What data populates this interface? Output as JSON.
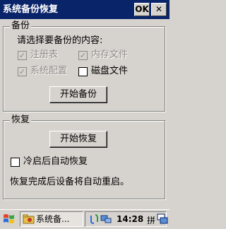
{
  "window": {
    "title": "系统备份恢复",
    "ok_label": "OK",
    "close_label": "✕"
  },
  "backup": {
    "group_title": "备份",
    "prompt": "请选择要备份的内容:",
    "options": [
      {
        "label": "注册表",
        "checked": true,
        "enabled": false
      },
      {
        "label": "内存文件",
        "checked": true,
        "enabled": false
      },
      {
        "label": "系统配置",
        "checked": true,
        "enabled": false
      },
      {
        "label": "磁盘文件",
        "checked": false,
        "enabled": true
      }
    ],
    "start_button": "开始备份"
  },
  "restore": {
    "group_title": "恢复",
    "start_button": "开始恢复",
    "auto_restore_label": "冷启后自动恢复",
    "auto_restore_checked": false,
    "note": "恢复完成后设备将自动重启。"
  },
  "taskbar": {
    "task_label": "系统备...",
    "clock": "14:28",
    "ime": "拼"
  },
  "icons": {
    "start": "windows-flag-icon",
    "task": "folder-icon",
    "tray": [
      "sync-icon",
      "network-icon"
    ],
    "desktop": "desktop-icon"
  },
  "colors": {
    "titlebar": "#0a246a",
    "face": "#d6d3ce",
    "disabled_text": "#8d8a85"
  }
}
